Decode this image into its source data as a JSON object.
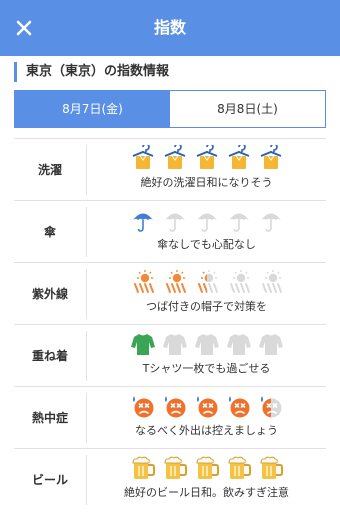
{
  "header": {
    "title": "指数",
    "close_icon": "close-icon"
  },
  "section": {
    "title": "東京（東京）の指数情報"
  },
  "tabs": [
    {
      "label": "8月7日(金)",
      "active": true
    },
    {
      "label": "8月8日(土)",
      "active": false
    }
  ],
  "rows": [
    {
      "label": "洗濯",
      "icon": "laundry-shirt-icon",
      "level": 5,
      "max": 5,
      "text": "絶好の洗濯日和になりそう"
    },
    {
      "label": "傘",
      "icon": "umbrella-icon",
      "level": 1,
      "max": 5,
      "text": "傘なしでも心配なし"
    },
    {
      "label": "紫外線",
      "icon": "uv-sun-icon",
      "level": 2.5,
      "max": 5,
      "text": "つば付きの帽子で対策を"
    },
    {
      "label": "重ね着",
      "icon": "sweater-icon",
      "level": 1,
      "max": 5,
      "text": "Tシャツ一枚でも過ごせる"
    },
    {
      "label": "熱中症",
      "icon": "heatstroke-face-icon",
      "level": 4.5,
      "max": 5,
      "text": "なるべく外出は控えましょう"
    },
    {
      "label": "ビール",
      "icon": "beer-mug-icon",
      "level": 5,
      "max": 5,
      "text": "絶好のビール日和。飲みすぎ注意"
    }
  ],
  "colors": {
    "accent": "#5a8fe6",
    "laundry": "#f5b731",
    "umbrella": "#3f7fd6",
    "uv": "#f08a3c",
    "sweater": "#3aa655",
    "heat": "#f0712c",
    "beer": "#f5c242",
    "inactive": "#d9d9d9"
  }
}
